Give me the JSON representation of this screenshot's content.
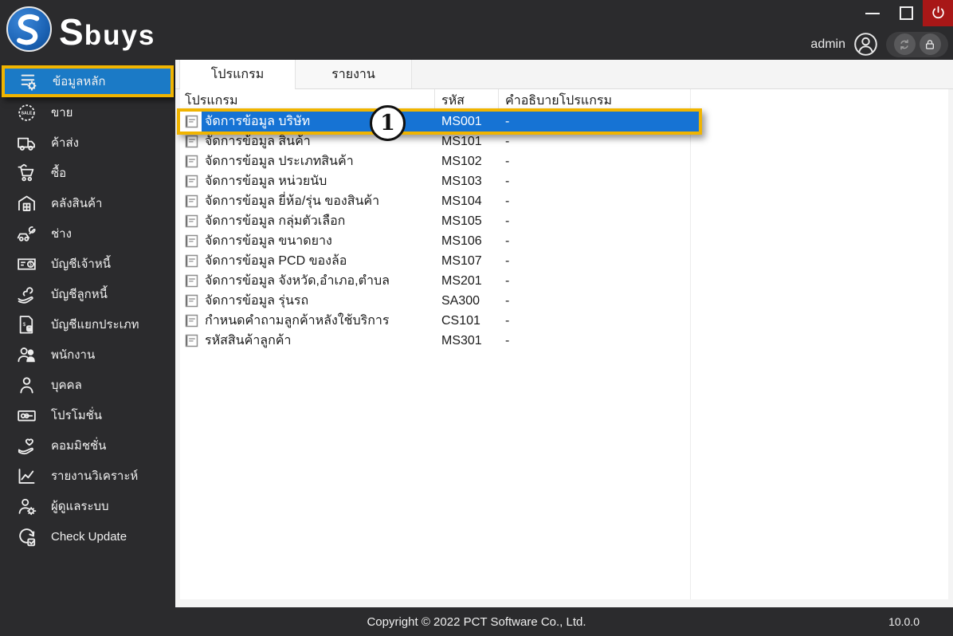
{
  "titlebar": {
    "brand": "Sbuys",
    "window_buttons": [
      "minimize",
      "maximize",
      "power"
    ],
    "user": {
      "name": "admin",
      "icons": [
        "user-avatar",
        "refresh",
        "lock"
      ]
    }
  },
  "sidebar": {
    "items": [
      {
        "label": "ข้อมูลหลัก",
        "icon": "master-data",
        "active": true
      },
      {
        "label": "ขาย",
        "icon": "sale",
        "active": false
      },
      {
        "label": "ค้าส่ง",
        "icon": "wholesale-truck",
        "active": false
      },
      {
        "label": "ซื้อ",
        "icon": "purchase-cart",
        "active": false
      },
      {
        "label": "คลังสินค้า",
        "icon": "warehouse",
        "active": false
      },
      {
        "label": "ช่าง",
        "icon": "mechanic",
        "active": false
      },
      {
        "label": "บัญชีเจ้าหนี้",
        "icon": "accounts-payable",
        "active": false
      },
      {
        "label": "บัญชีลูกหนี้",
        "icon": "accounts-receivable",
        "active": false
      },
      {
        "label": "บัญชีแยกประเภท",
        "icon": "general-ledger",
        "active": false
      },
      {
        "label": "พนักงาน",
        "icon": "employees",
        "active": false
      },
      {
        "label": "บุคคล",
        "icon": "person",
        "active": false
      },
      {
        "label": "โปรโมชั่น",
        "icon": "promotion",
        "active": false
      },
      {
        "label": "คอมมิชชั่น",
        "icon": "commission",
        "active": false
      },
      {
        "label": "รายงานวิเคราะห์",
        "icon": "analytics-report",
        "active": false
      },
      {
        "label": "ผู้ดูแลระบบ",
        "icon": "administrator",
        "active": false
      },
      {
        "label": "Check Update",
        "icon": "check-update",
        "active": false
      }
    ]
  },
  "tabs": [
    {
      "label": "โปรแกรม",
      "active": true
    },
    {
      "label": "รายงาน",
      "active": false
    }
  ],
  "table": {
    "columns": [
      {
        "label": "โปรแกรม"
      },
      {
        "label": "รหัส"
      },
      {
        "label": "คำอธิบายโปรแกรม"
      }
    ],
    "rows": [
      {
        "name": "จัดการข้อมูล บริษัท",
        "code": "MS001",
        "desc": "-",
        "selected": true
      },
      {
        "name": "จัดการข้อมูล สินค้า",
        "code": "MS101",
        "desc": "-",
        "selected": false
      },
      {
        "name": "จัดการข้อมูล ประเภทสินค้า",
        "code": "MS102",
        "desc": "-",
        "selected": false
      },
      {
        "name": "จัดการข้อมูล หน่วยนับ",
        "code": "MS103",
        "desc": "-",
        "selected": false
      },
      {
        "name": "จัดการข้อมูล ยี่ห้อ/รุ่น ของสินค้า",
        "code": "MS104",
        "desc": "-",
        "selected": false
      },
      {
        "name": "จัดการข้อมูล กลุ่มตัวเลือก",
        "code": "MS105",
        "desc": "-",
        "selected": false
      },
      {
        "name": "จัดการข้อมูล ขนาดยาง",
        "code": "MS106",
        "desc": "-",
        "selected": false
      },
      {
        "name": "จัดการข้อมูล PCD ของล้อ",
        "code": "MS107",
        "desc": "-",
        "selected": false
      },
      {
        "name": "จัดการข้อมูล จังหวัด,อำเภอ,ตำบล",
        "code": "MS201",
        "desc": "-",
        "selected": false
      },
      {
        "name": "จัดการข้อมูล รุ่นรถ",
        "code": "SA300",
        "desc": "-",
        "selected": false
      },
      {
        "name": "กำหนดคำถามลูกค้าหลังใช้บริการ",
        "code": "CS101",
        "desc": "-",
        "selected": false
      },
      {
        "name": "รหัสสินค้าลูกค้า",
        "code": "MS301",
        "desc": "-",
        "selected": false
      }
    ]
  },
  "annotation": {
    "step": "1"
  },
  "footer": {
    "copyright": "Copyright © 2022 PCT Software Co., Ltd.",
    "version": "10.0.0"
  },
  "colors": {
    "titlebar_dark": "#2b2b2d",
    "selection_blue": "#1673d4",
    "sidebar_selected_blue": "#1b7ac6",
    "highlight_yellow": "#f0b400",
    "power_red": "#a81717"
  }
}
